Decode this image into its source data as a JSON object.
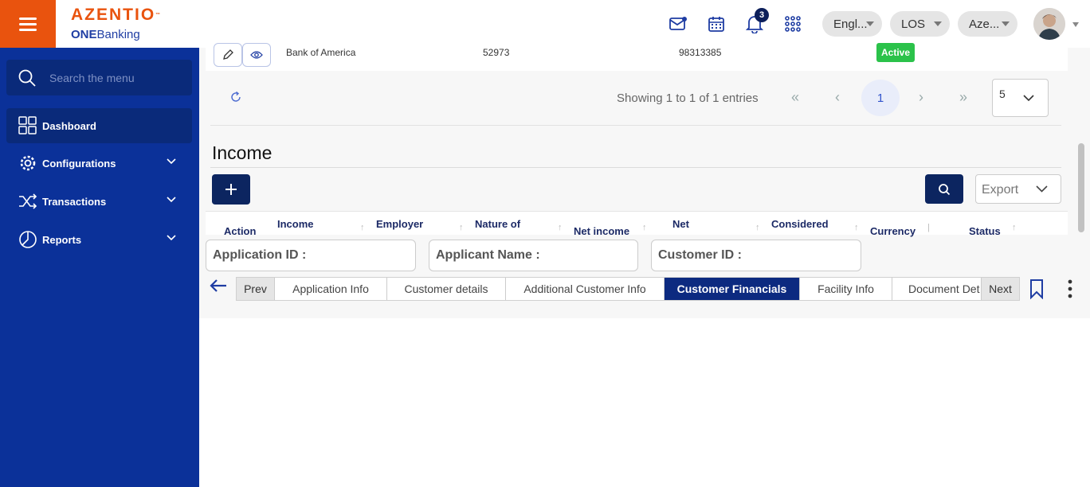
{
  "header": {
    "brand": "AZENTIO",
    "brand_tm": "™",
    "product_bold": "ONE",
    "product_rest": "Banking",
    "notification_count": "3",
    "language": "Engl...",
    "module": "LOS",
    "entity": "Aze..."
  },
  "sidebar": {
    "search_placeholder": "Search the menu",
    "items": [
      {
        "label": "Dashboard",
        "icon": "dashboard-grid-icon"
      },
      {
        "label": "Configurations",
        "icon": "gear-icon"
      },
      {
        "label": "Transactions",
        "icon": "shuffle-icon"
      },
      {
        "label": "Reports",
        "icon": "pie-chart-icon"
      }
    ]
  },
  "top_row": {
    "bank": "Bank of America",
    "col2": "52973",
    "col3": "98313385",
    "status": "Active"
  },
  "pagination": {
    "showing": "Showing 1 to 1 of 1 entries",
    "first": "«",
    "prev": "‹",
    "current": "1",
    "next": "›",
    "last": "»",
    "page_size": "5"
  },
  "income": {
    "title": "Income",
    "add_label": "+",
    "export_label": "Export",
    "columns": [
      "Action",
      "Income",
      "Employer",
      "Nature of",
      "Net income",
      "Net",
      "Considered",
      "Currency",
      "Status"
    ]
  },
  "ids": {
    "application": "Application ID :",
    "applicant": "Applicant Name :",
    "customer": "Customer ID :"
  },
  "tabs": {
    "prev": "Prev",
    "next": "Next",
    "items": [
      "Application Info",
      "Customer details",
      "Additional Customer Info",
      "Customer Financials",
      "Facility Info",
      "Document Det"
    ],
    "active": "Customer Financials"
  },
  "colors": {
    "brand_orange": "#e9530e",
    "sidebar_blue": "#0b3199",
    "active_tab": "#0c2a80",
    "status_green": "#2bc24a"
  }
}
